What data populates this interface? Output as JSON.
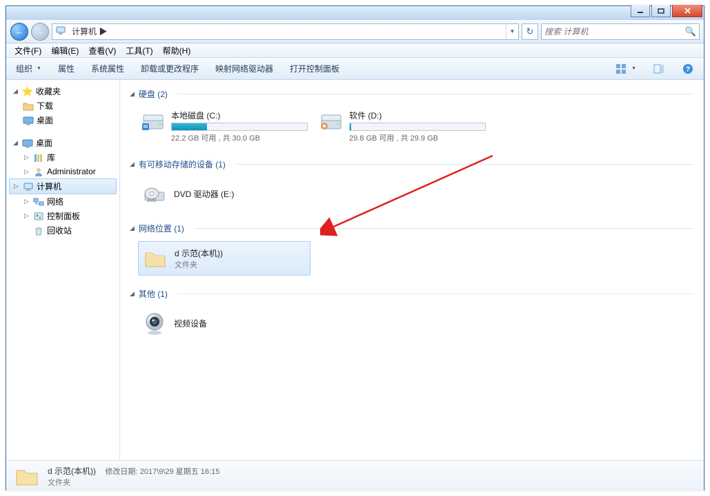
{
  "window": {
    "breadcrumb": "计算机 ▶",
    "search_placeholder": "搜索 计算机"
  },
  "menu": {
    "file": "文件(F)",
    "edit": "编辑(E)",
    "view": "查看(V)",
    "tools": "工具(T)",
    "help": "帮助(H)"
  },
  "toolbar": {
    "organize": "组织",
    "properties": "属性",
    "system_properties": "系统属性",
    "uninstall": "卸载或更改程序",
    "map_drive": "映射网络驱动器",
    "control_panel": "打开控制面板"
  },
  "sidebar": {
    "favorites": "收藏夹",
    "downloads": "下载",
    "desktop_fav": "桌面",
    "desktop": "桌面",
    "libraries": "库",
    "administrator": "Administrator",
    "computer": "计算机",
    "network": "网络",
    "control_panel": "控制面板",
    "recycle_bin": "回收站"
  },
  "sections": {
    "drives": "硬盘 (2)",
    "removable": "有可移动存储的设备 (1)",
    "network_loc": "网络位置 (1)",
    "other": "其他 (1)"
  },
  "drives": {
    "c": {
      "title": "本地磁盘 (C:)",
      "sub": "22.2 GB 可用 , 共 30.0 GB",
      "fill": 26
    },
    "d": {
      "title": "软件 (D:)",
      "sub": "29.8 GB 可用 , 共 29.9 GB",
      "fill": 1
    }
  },
  "dvd": {
    "title": "DVD 驱动器 (E:)"
  },
  "netloc": {
    "title": "d 示范(本机))",
    "sub": "文件夹"
  },
  "other": {
    "title": "视频设备"
  },
  "status": {
    "name": "d 示范(本机))",
    "meta_label": "修改日期:",
    "meta_value": "2017\\9\\29 星期五 16:15",
    "type": "文件夹"
  }
}
